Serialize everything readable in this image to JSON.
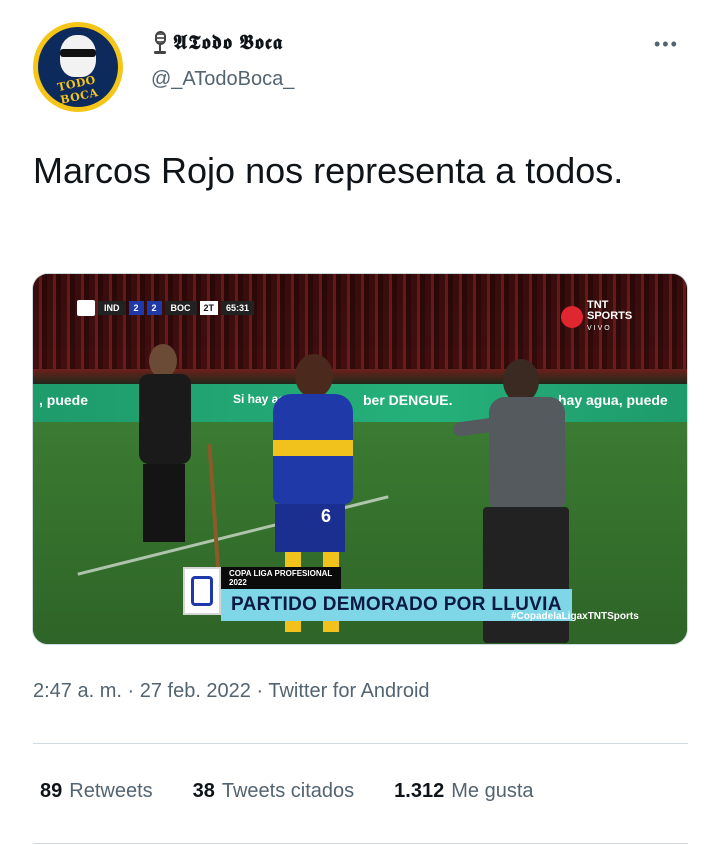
{
  "author": {
    "display_name": "𝕬𝕿𝖔𝖉𝖔 𝕭𝖔𝖈𝖆",
    "handle": "@_ATodoBoca_",
    "avatar_text": "TODO BOCA",
    "icons": [
      "microphone-icon",
      "apple-icon"
    ]
  },
  "more_menu": "•••",
  "tweet": {
    "text": "Marcos Rojo nos representa a todos."
  },
  "media": {
    "scorebug": {
      "home": "IND",
      "home_score": "2",
      "away_score": "2",
      "away": "BOC",
      "half": "2T",
      "clock": "65:31"
    },
    "broadcaster_line1": "TNT",
    "broadcaster_line2": "SPORTS",
    "broadcaster_line3": "VIVO",
    "adboard_left": ", puede",
    "adboard_mid1": "Si hay agua",
    "adboard_mid2": "ber DENGUE.",
    "adboard_right": "hay agua, puede",
    "lower_third_sub": "COPA LIGA PROFESIONAL 2022",
    "lower_third_title": "PARTIDO DEMORADO POR LLUVIA",
    "hashtag": "#CopadelaLigaxTNTSports",
    "player_number": "6"
  },
  "meta": {
    "timestamp": "2:47 a. m. · 27 feb. 2022 · Twitter for Android"
  },
  "stats": {
    "retweets_count": "89",
    "retweets_label": "Retweets",
    "quotes_count": "38",
    "quotes_label": "Tweets citados",
    "likes_count": "1.312",
    "likes_label": "Me gusta"
  },
  "colors": {
    "text_primary": "#0f1419",
    "text_secondary": "#536471",
    "divider": "#cfd9de",
    "boca_blue": "#1f3aa8",
    "boca_gold": "#f1c21b"
  }
}
